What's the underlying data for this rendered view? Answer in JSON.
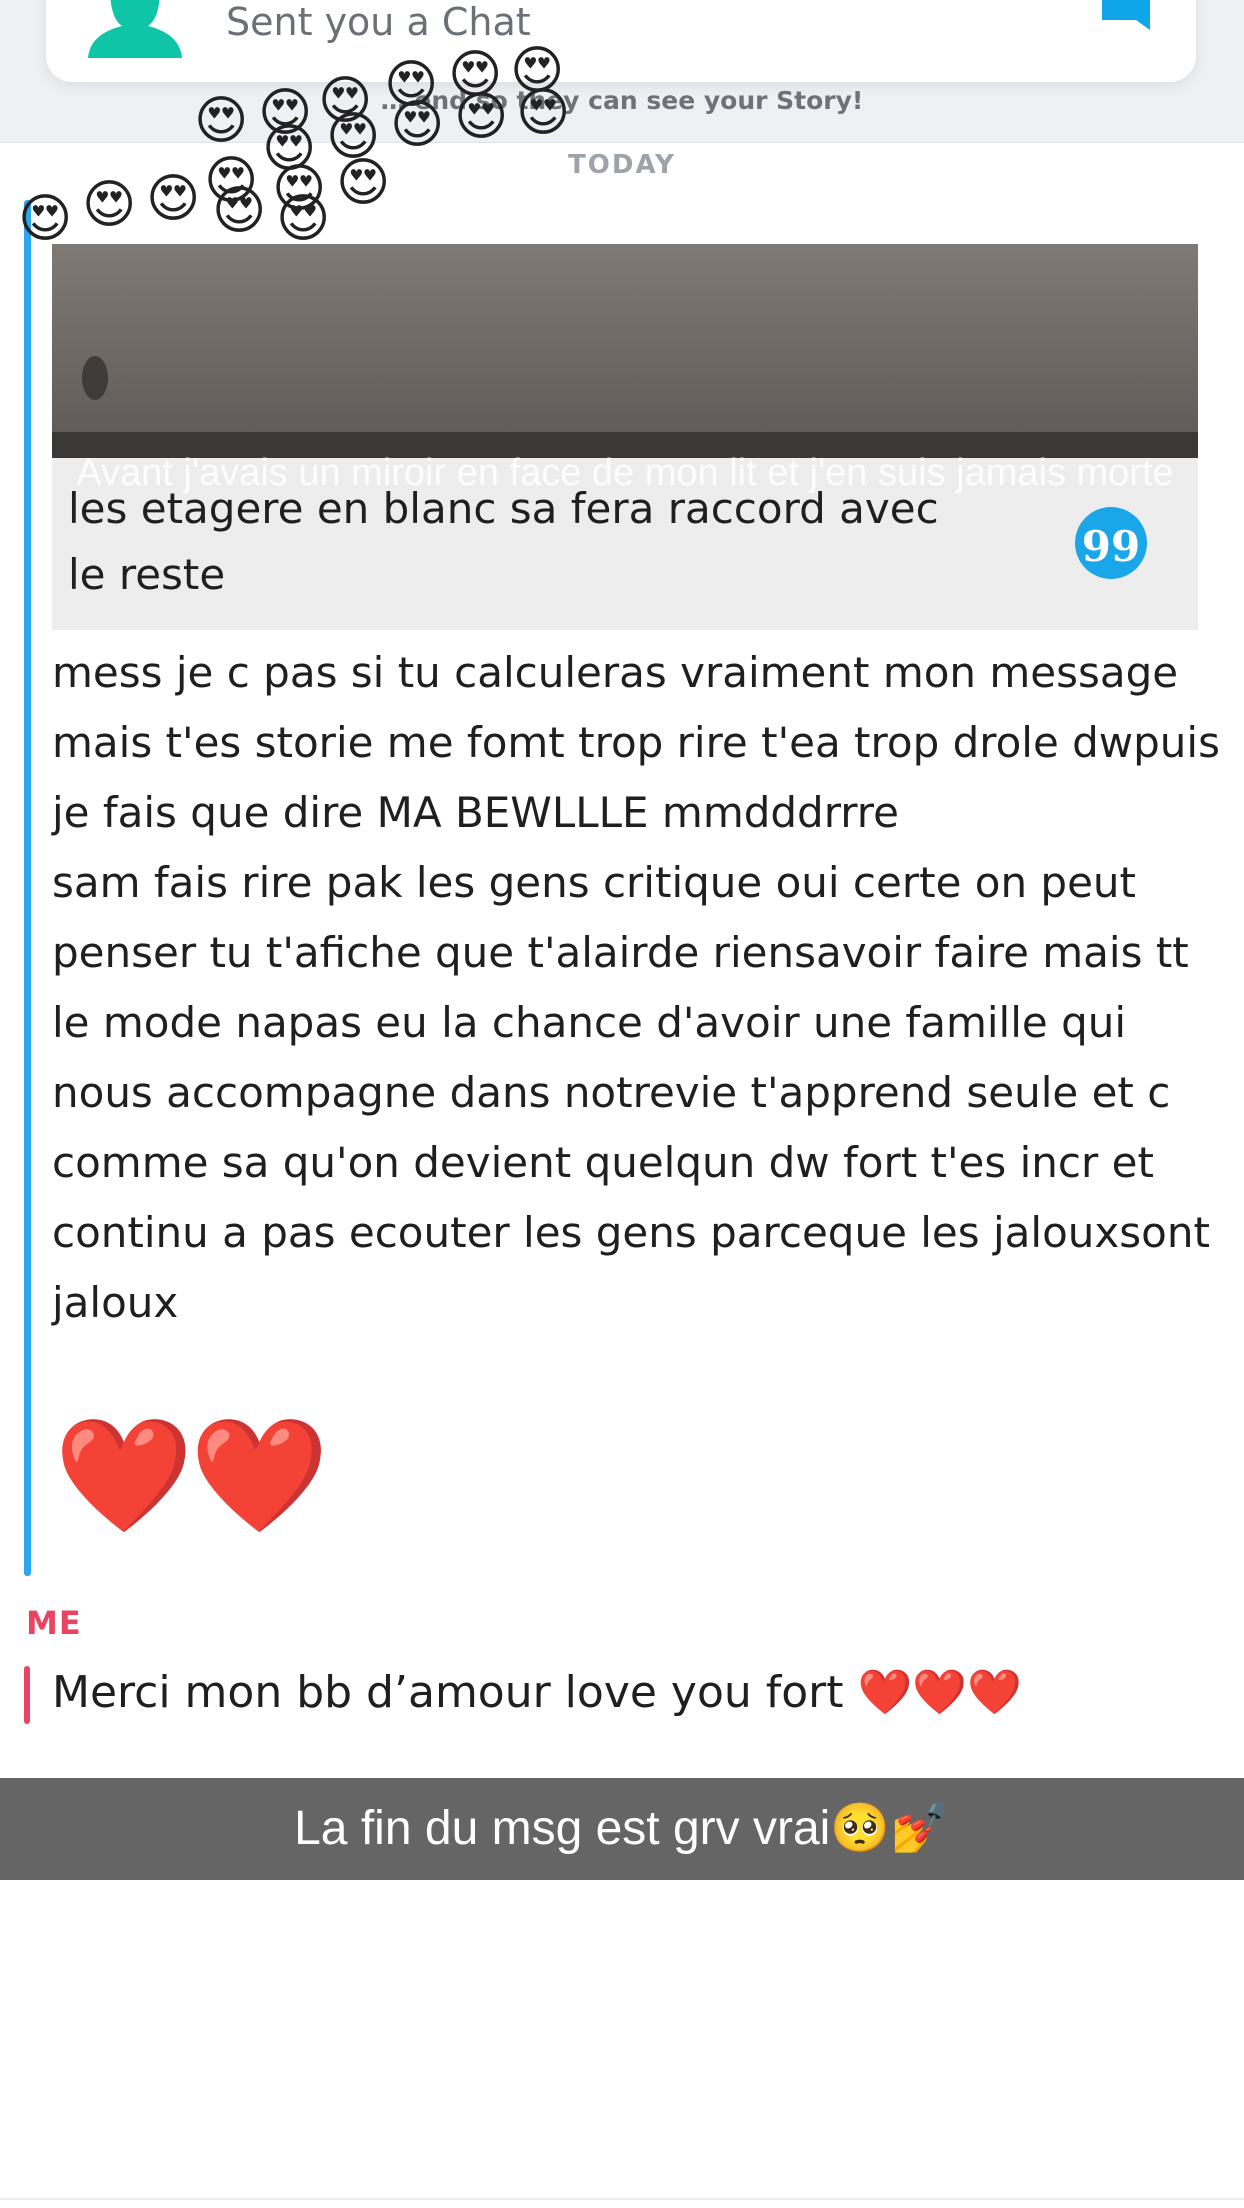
{
  "notification": {
    "text": "Sent you a Chat",
    "avatar_icon": "ghost-avatar-icon",
    "chat_icon": "chat-bubble-icon",
    "accent_color": "#0fc5a8"
  },
  "banner": {
    "text": "… end so they can see your Story!"
  },
  "date_divider": "TODAY",
  "story_reply": {
    "caption": "Avant j'avais un miroir en face de mon lit et j'en suis jamais morte",
    "reply_text": "les etagere en blanc sa fera raccord avec le reste",
    "quote_icon": "quote-icon",
    "quote_glyph": "99",
    "accent_color": "#1aa7ea"
  },
  "friend_message": {
    "text": "mess je c pas si tu calculeras vraiment mon message mais t'es storie me fomt trop rire t'ea trop drole dwpuis je fais que dire MA BEWLLLE mmdddrrre\nsam fais rire pak les gens critique oui certe on peut penser tu t'afiche que t'alairde riensavoir faire mais tt le mode napas eu la chance d'avoir une famille qui nous accompagne dans notrevie t'apprend seule et c comme sa qu'on devient quelqun dw fort t'es incr et continu a pas ecouter les gens parceque les jalouxsont jaloux",
    "hearts": "❤️❤️",
    "bar_color": "#2ea6ee"
  },
  "me": {
    "label": "ME",
    "message": "Merci mon bb d’amour love you fort ❤️❤️❤️",
    "color": "#e94562"
  },
  "overlay_caption": "La fin du msg est grv vrai🥺💅",
  "sticker_emoji": "😍"
}
